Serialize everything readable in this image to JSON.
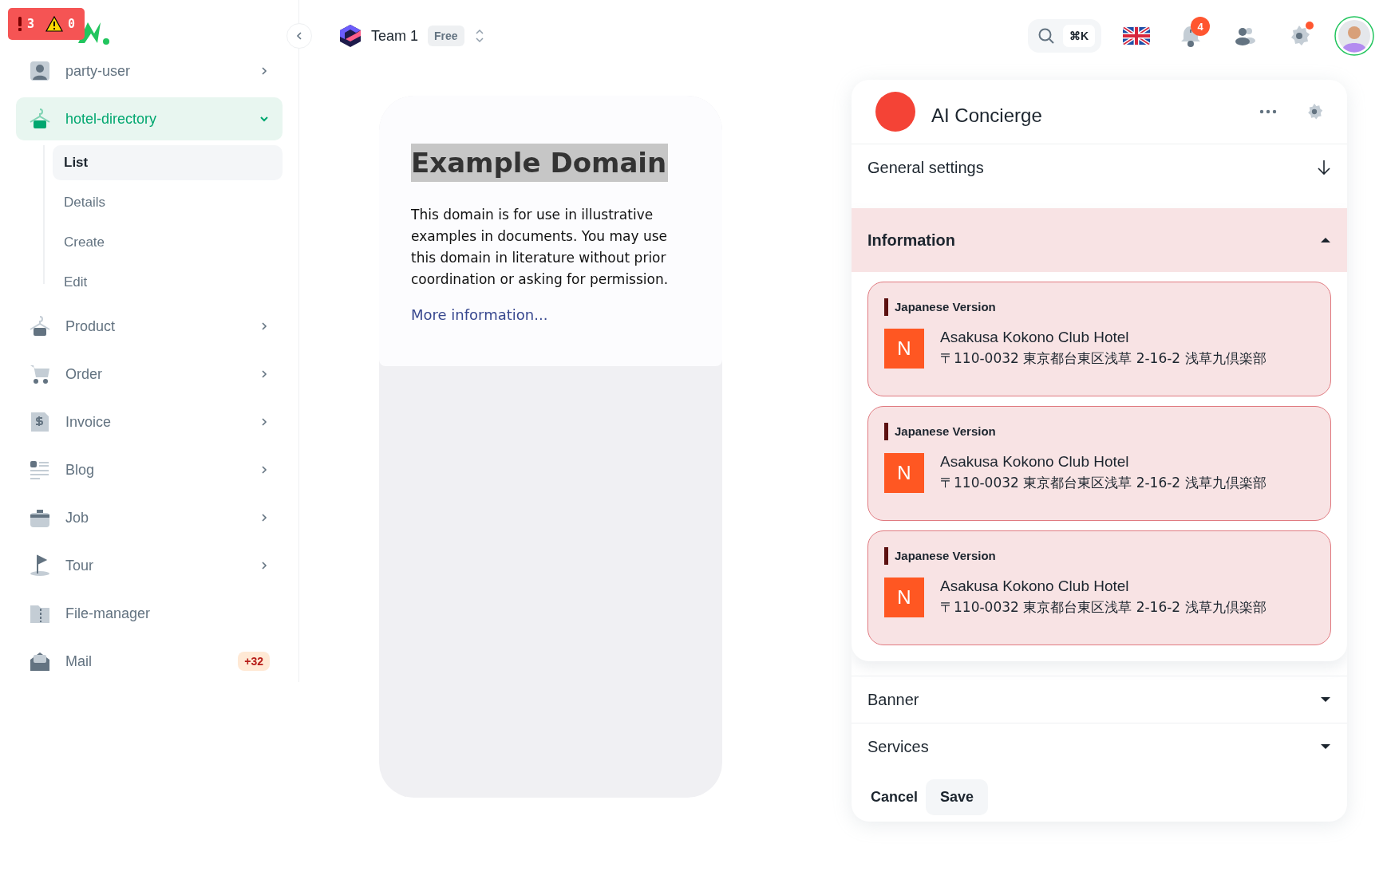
{
  "dev_badge": {
    "errors": "3",
    "warnings": "0"
  },
  "sidebar": {
    "items": [
      {
        "label": "party-user",
        "selected": false,
        "expanded": false
      },
      {
        "label": "hotel-directory",
        "selected": true,
        "expanded": true,
        "children": [
          {
            "label": "List",
            "selected": true
          },
          {
            "label": "Details",
            "selected": false
          },
          {
            "label": "Create",
            "selected": false
          },
          {
            "label": "Edit",
            "selected": false
          }
        ]
      },
      {
        "label": "Product",
        "selected": false,
        "expanded": false
      },
      {
        "label": "Order",
        "selected": false,
        "expanded": false
      },
      {
        "label": "Invoice",
        "selected": false,
        "expanded": false
      },
      {
        "label": "Blog",
        "selected": false,
        "expanded": false
      },
      {
        "label": "Job",
        "selected": false,
        "expanded": false
      },
      {
        "label": "Tour",
        "selected": false,
        "expanded": false
      },
      {
        "label": "File-manager",
        "selected": false
      },
      {
        "label": "Mail",
        "selected": false,
        "badge": "+32"
      }
    ]
  },
  "topbar": {
    "team": {
      "name": "Team 1",
      "plan": "Free"
    },
    "search": {
      "shortcut": "⌘K"
    },
    "notifications": {
      "count": "4"
    },
    "settings": {
      "alert": true
    }
  },
  "preview": {
    "heading": "Example Domain",
    "highlighted": true,
    "text": "This domain is for use in illustrative examples in documents. You may use this domain in literature without prior coordination or asking for permission.",
    "link": "More information..."
  },
  "panel": {
    "title": "AI Concierge",
    "sections": [
      {
        "label": "General settings",
        "kind": "arrow",
        "expanded": false
      },
      {
        "label": "Information",
        "kind": "caret",
        "expanded": true,
        "items": [
          {
            "tag": "Japanese Version",
            "initial": "N",
            "name": "Asakusa Kokono Club Hotel",
            "address": "〒110-0032 東京都台東区浅草 2-16-2 浅草九倶楽部"
          },
          {
            "tag": "Japanese Version",
            "initial": "N",
            "name": "Asakusa Kokono Club Hotel",
            "address": "〒110-0032 東京都台東区浅草 2-16-2 浅草九倶楽部"
          },
          {
            "tag": "Japanese Version",
            "initial": "N",
            "name": "Asakusa Kokono Club Hotel",
            "address": "〒110-0032 東京都台東区浅草 2-16-2 浅草九倶楽部"
          }
        ]
      },
      {
        "label": "Banner",
        "kind": "caret",
        "expanded": false
      },
      {
        "label": "Services",
        "kind": "caret",
        "expanded": false
      }
    ],
    "buttons": [
      {
        "label": "Cancel",
        "kind": "text"
      },
      {
        "label": "Save",
        "kind": "filled"
      }
    ]
  }
}
